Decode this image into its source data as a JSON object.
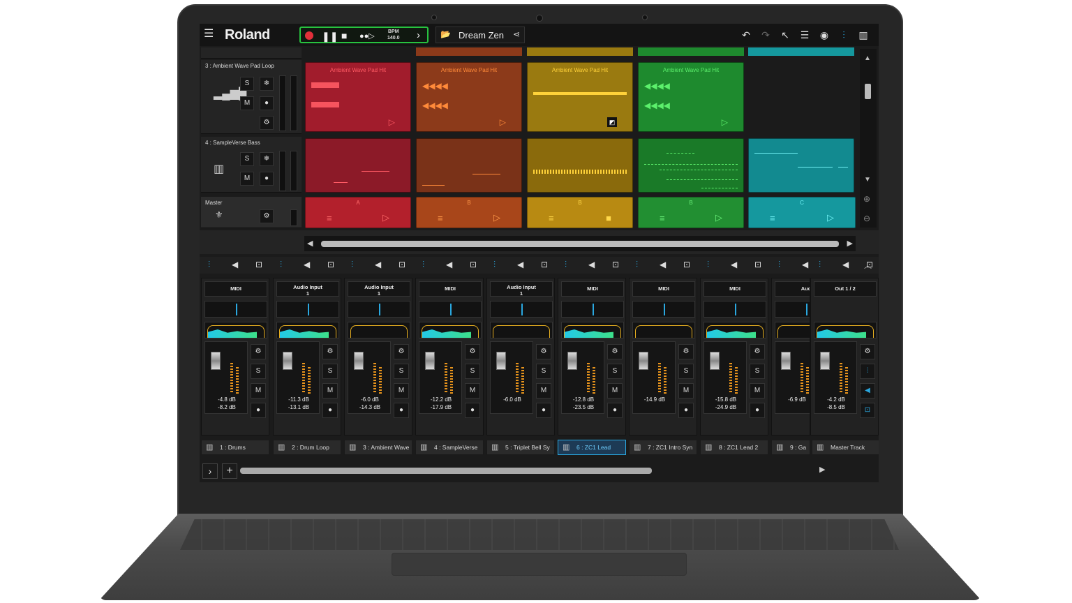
{
  "app": {
    "logo": "Roland",
    "project_name": "Dream Zen"
  },
  "transport": {
    "bpm_label": "BPM",
    "bpm_value": "140.0"
  },
  "tracks": [
    {
      "name": "3 : Ambient Wave Pad Loop"
    },
    {
      "name": "4 : SampleVerse Bass"
    },
    {
      "name": "Master"
    }
  ],
  "clips_row1": [
    {
      "name": "Ambient Wave Pad Hit",
      "color": "#a11c2c",
      "fg": "#ff5a64"
    },
    {
      "name": "Ambient Wave Pad Hit",
      "color": "#8c3a1a",
      "fg": "#ff8a3a"
    },
    {
      "name": "Ambient Wave Pad Hit",
      "color": "#9a7a10",
      "fg": "#ffd23a"
    },
    {
      "name": "Ambient Wave Pad Hit",
      "color": "#1e8a2e",
      "fg": "#5cf06c"
    }
  ],
  "scenes": [
    {
      "name": "A",
      "color": "#b3202c",
      "fg": "#ff6a6a"
    },
    {
      "name": "B",
      "color": "#a8461a",
      "fg": "#ff9a4a"
    },
    {
      "name": "B",
      "color": "#b88a12",
      "fg": "#ffd84a"
    },
    {
      "name": "B",
      "color": "#228f32",
      "fg": "#6af07a"
    },
    {
      "name": "C",
      "color": "#15989e",
      "fg": "#6ff0f4"
    }
  ],
  "mixer": [
    {
      "input": "MIDI",
      "db1": "-4.8 dB",
      "db2": "-8.2 dB"
    },
    {
      "input": "Audio Input\n1",
      "db1": "-11.3 dB",
      "db2": "-13.1 dB"
    },
    {
      "input": "Audio Input\n1",
      "db1": "-6.0 dB",
      "db2": "-14.3 dB"
    },
    {
      "input": "MIDI",
      "db1": "-12.2 dB",
      "db2": "-17.9 dB"
    },
    {
      "input": "Audio Input\n1",
      "db1": "-6.0 dB",
      "db2": ""
    },
    {
      "input": "MIDI",
      "db1": "-12.8 dB",
      "db2": "-23.5 dB"
    },
    {
      "input": "MIDI",
      "db1": "-14.9 dB",
      "db2": ""
    },
    {
      "input": "MIDI",
      "db1": "-15.8 dB",
      "db2": "-24.9 dB"
    },
    {
      "input": "Aud",
      "db1": "-6.9 dB",
      "db2": ""
    },
    {
      "input": "Out 1 / 2",
      "db1": "-4.2 dB",
      "db2": "-8.5 dB"
    }
  ],
  "track_tabs": [
    {
      "label": "1 : Drums"
    },
    {
      "label": "2 : Drum Loop"
    },
    {
      "label": "3 : Ambient Wave"
    },
    {
      "label": "4 : SampleVerse"
    },
    {
      "label": "5 : Triplet Bell Sy"
    },
    {
      "label": "6 : ZC1 Lead"
    },
    {
      "label": "7 : ZC1 Intro Syn"
    },
    {
      "label": "8 : ZC1 Lead 2"
    },
    {
      "label": "9 : Ga"
    },
    {
      "label": "Master Track"
    }
  ],
  "buttons": {
    "solo": "S",
    "mute": "M"
  }
}
